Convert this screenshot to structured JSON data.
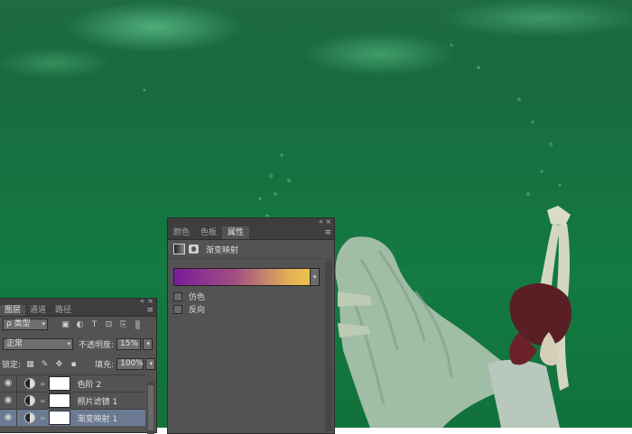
{
  "properties_panel": {
    "tabs": [
      {
        "label": "颜色",
        "active": false
      },
      {
        "label": "色板",
        "active": false
      },
      {
        "label": "属性",
        "active": true
      }
    ],
    "header_title": "渐变映射",
    "gradient": {
      "from_color": "#7a1c9a",
      "to_color": "#ecc34c"
    },
    "checkboxes": [
      {
        "label": "仿色",
        "checked": false
      },
      {
        "label": "反向",
        "checked": false
      }
    ]
  },
  "layers_panel": {
    "tabs": [
      {
        "label": "图层",
        "active": true
      },
      {
        "label": "通道",
        "active": false
      },
      {
        "label": "路径",
        "active": false
      }
    ],
    "filter_label": "ρ 类型",
    "blend_mode": "正常",
    "opacity_label": "不透明度:",
    "opacity_value": "15%",
    "lock_label": "锁定:",
    "fill_label": "填充:",
    "fill_value": "100%",
    "layers": [
      {
        "name": "色阶 2",
        "selected": false
      },
      {
        "name": "照片滤镜 1",
        "selected": false
      },
      {
        "name": "渐变映射 1",
        "selected": true
      }
    ]
  },
  "colors": {
    "panel_bg": "#535353",
    "panel_header": "#3e3e3e",
    "selection": "#6b7a92",
    "water": "#137a41"
  },
  "icons": {
    "collapse": "«",
    "close": "×",
    "menu": "≡",
    "eye": "👁",
    "chain": "∞",
    "dropdown": "▾"
  }
}
